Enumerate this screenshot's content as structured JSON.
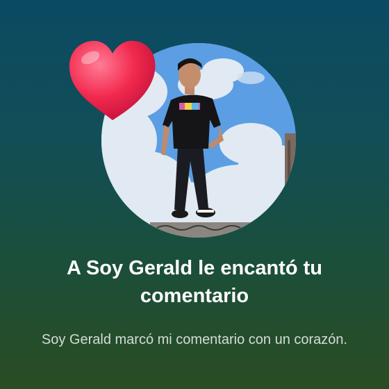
{
  "notification": {
    "title": "A Soy Gerald le encantó tu comentario",
    "body": "Soy Gerald marcó mi comentario con un corazón."
  },
  "icons": {
    "heart": "heart-icon",
    "avatar": "profile-photo"
  },
  "colors": {
    "background_top": "#0b4a63",
    "background_bottom": "#2a4c22",
    "heart": "#f2294f",
    "title_text": "#ffffff",
    "body_text": "#d6dcd7"
  }
}
